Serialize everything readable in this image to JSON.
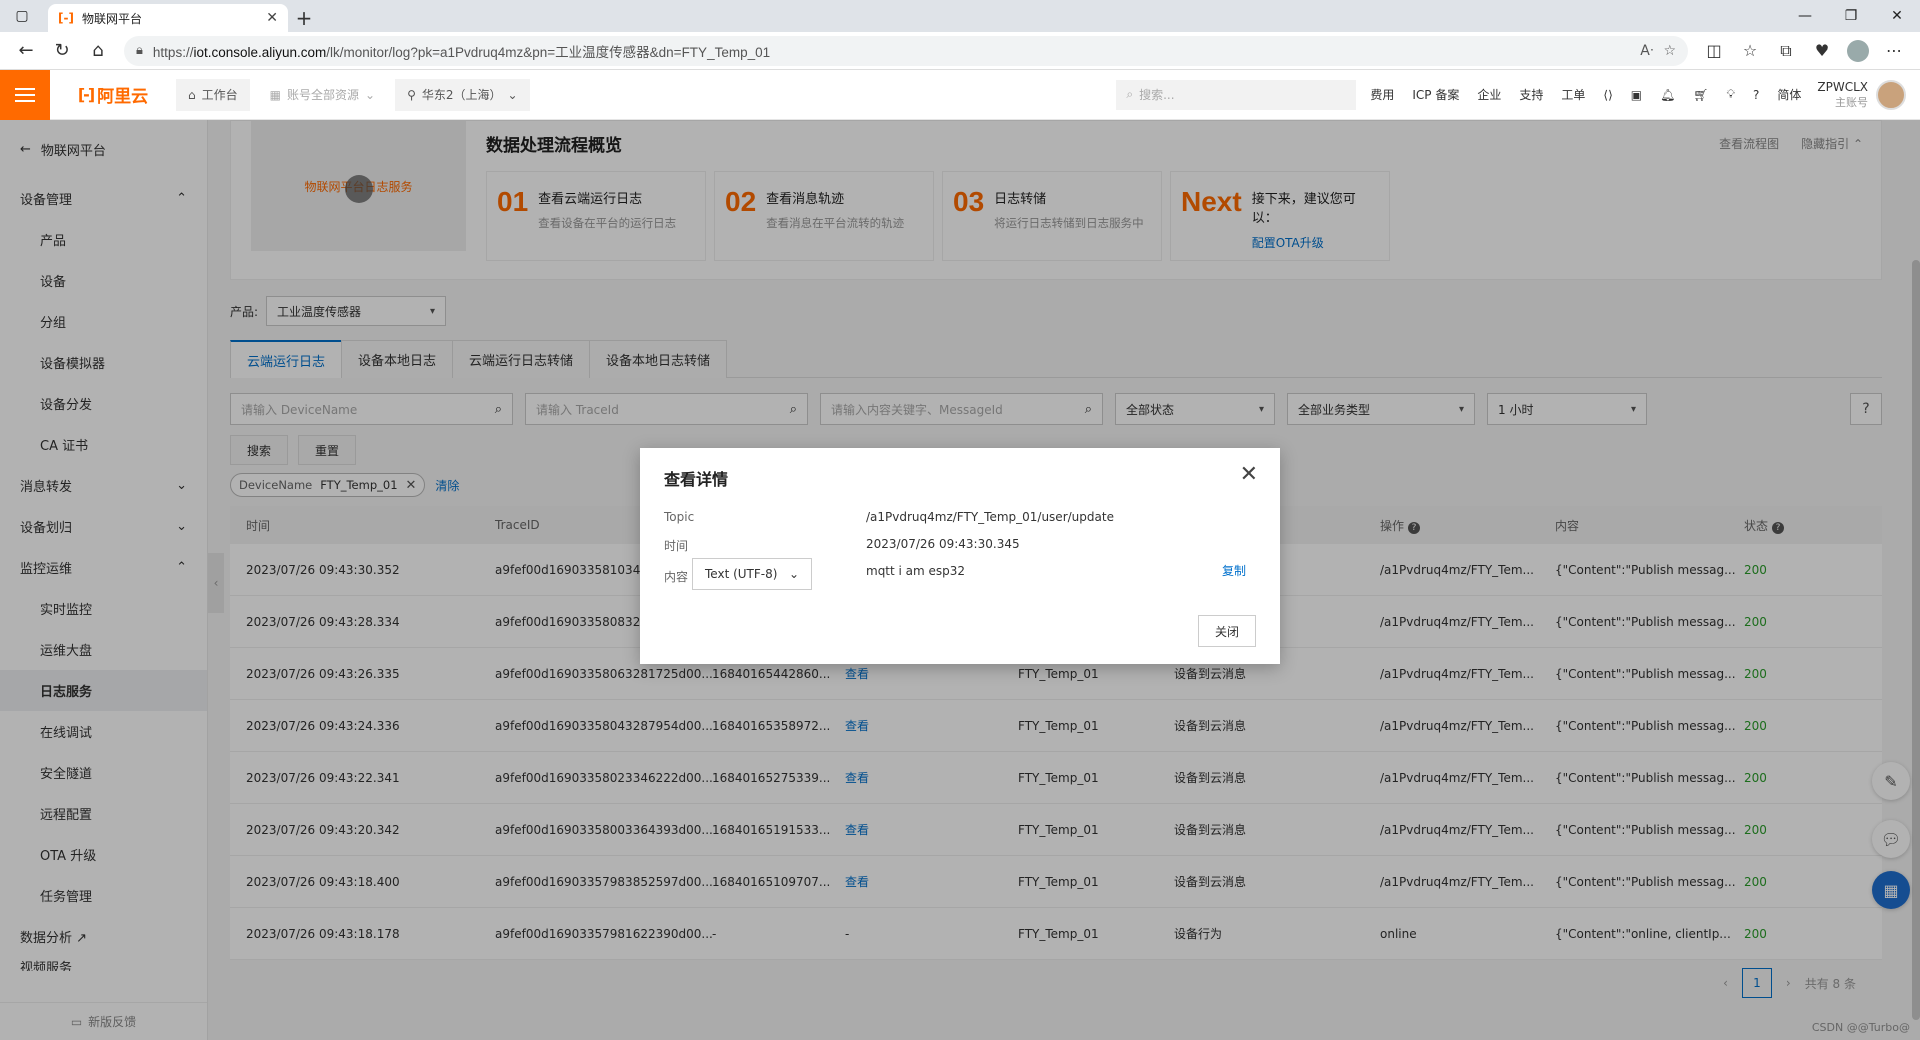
{
  "browser": {
    "tab_title": "物联网平台",
    "url_prefix": "https://",
    "url_host": "iot.console.aliyun.com",
    "url_path": "/lk/monitor/log?pk=a1Pvdruq4mz&pn=工业温度传感器&dn=FTY_Temp_01"
  },
  "topbar": {
    "logo": "阿里云",
    "workbench": "工作台",
    "account_resources": "账号全部资源",
    "region": "华东2（上海）",
    "search_placeholder": "搜索...",
    "links": [
      "费用",
      "ICP 备案",
      "企业",
      "支持",
      "工单"
    ],
    "lang": "简体",
    "user_name": "ZPWCLX",
    "user_role": "主账号"
  },
  "sidebar": {
    "back": "物联网平台",
    "groups": [
      {
        "label": "设备管理",
        "items": [
          "产品",
          "设备",
          "分组",
          "设备模拟器",
          "设备分发",
          "CA 证书"
        ]
      },
      {
        "label": "消息转发",
        "items": []
      },
      {
        "label": "设备划归",
        "items": []
      },
      {
        "label": "监控运维",
        "items": [
          "实时监控",
          "运维大盘",
          "日志服务",
          "在线调试",
          "安全隧道",
          "远程配置",
          "OTA 升级",
          "任务管理"
        ]
      }
    ],
    "data_analysis": "数据分析",
    "cutoff": "视频服务",
    "feedback": "新版反馈"
  },
  "flow": {
    "video_text": "物联网平台日志服务",
    "title": "数据处理流程概览",
    "view_flow": "查看流程图",
    "hide_guide": "隐藏指引",
    "steps": [
      {
        "num": "01",
        "title": "查看云端运行日志",
        "desc": "查看设备在平台的运行日志"
      },
      {
        "num": "02",
        "title": "查看消息轨迹",
        "desc": "查看消息在平台流转的轨迹"
      },
      {
        "num": "03",
        "title": "日志转储",
        "desc": "将运行日志转储到日志服务中"
      },
      {
        "num": "Next",
        "title": "接下来，建议您可以：",
        "link": "配置OTA升级"
      }
    ]
  },
  "filters": {
    "product_label": "产品:",
    "product_value": "工业温度传感器",
    "tabs": [
      "云端运行日志",
      "设备本地日志",
      "云端运行日志转储",
      "设备本地日志转储"
    ],
    "device_placeholder": "请输入 DeviceName",
    "trace_placeholder": "请输入 TraceId",
    "content_placeholder": "请输入内容关键字、MessageId",
    "status": "全部状态",
    "biz_type": "全部业务类型",
    "time_range": "1 小时",
    "search_btn": "搜索",
    "reset_btn": "重置",
    "chip_key": "DeviceName",
    "chip_value": "FTY_Temp_01",
    "clear": "清除"
  },
  "table": {
    "headers": [
      "时间",
      "TraceID",
      "",
      "",
      "",
      "",
      "操作",
      "内容",
      "状态"
    ],
    "rows": [
      [
        "2023/07/26 09:43:30.352",
        "a9fef00d169033581034",
        "",
        "",
        "",
        "",
        "/a1Pvdruq4mz/FTY_Tem...",
        "{\"Content\":\"Publish messag...",
        "200"
      ],
      [
        "2023/07/26 09:43:28.334",
        "a9fef00d169033580832",
        "",
        "",
        "",
        "",
        "/a1Pvdruq4mz/FTY_Tem...",
        "{\"Content\":\"Publish messag...",
        "200"
      ],
      [
        "2023/07/26 09:43:26.335",
        "a9fef00d16903358063281725d00...",
        "16840165442860...",
        "查看",
        "FTY_Temp_01",
        "设备到云消息",
        "/a1Pvdruq4mz/FTY_Tem...",
        "{\"Content\":\"Publish messag...",
        "200"
      ],
      [
        "2023/07/26 09:43:24.336",
        "a9fef00d16903358043287954d00...",
        "16840165358972...",
        "查看",
        "FTY_Temp_01",
        "设备到云消息",
        "/a1Pvdruq4mz/FTY_Tem...",
        "{\"Content\":\"Publish messag...",
        "200"
      ],
      [
        "2023/07/26 09:43:22.341",
        "a9fef00d16903358023346222d00...",
        "16840165275339...",
        "查看",
        "FTY_Temp_01",
        "设备到云消息",
        "/a1Pvdruq4mz/FTY_Tem...",
        "{\"Content\":\"Publish messag...",
        "200"
      ],
      [
        "2023/07/26 09:43:20.342",
        "a9fef00d16903358003364393d00...",
        "16840165191533...",
        "查看",
        "FTY_Temp_01",
        "设备到云消息",
        "/a1Pvdruq4mz/FTY_Tem...",
        "{\"Content\":\"Publish messag...",
        "200"
      ],
      [
        "2023/07/26 09:43:18.400",
        "a9fef00d16903357983852597d00...",
        "16840165109707...",
        "查看",
        "FTY_Temp_01",
        "设备到云消息",
        "/a1Pvdruq4mz/FTY_Tem...",
        "{\"Content\":\"Publish messag...",
        "200"
      ],
      [
        "2023/07/26 09:43:18.178",
        "a9fef00d16903357981622390d00...",
        "-",
        "-",
        "FTY_Temp_01",
        "设备行为",
        "online",
        "{\"Content\":\"online, clientIp...",
        "200"
      ]
    ]
  },
  "pager": {
    "page": "1",
    "total": "共有 8 条"
  },
  "modal": {
    "title": "查看详情",
    "topic_label": "Topic",
    "topic_value": "/a1Pvdruq4mz/FTY_Temp_01/user/update",
    "time_label": "时间",
    "time_value": "2023/07/26 09:43:30.345",
    "content_label": "内容",
    "encoding": "Text (UTF-8)",
    "content_value": "mqtt i am esp32",
    "copy": "复制",
    "close_btn": "关闭"
  },
  "watermark": "CSDN @@Turbo@"
}
